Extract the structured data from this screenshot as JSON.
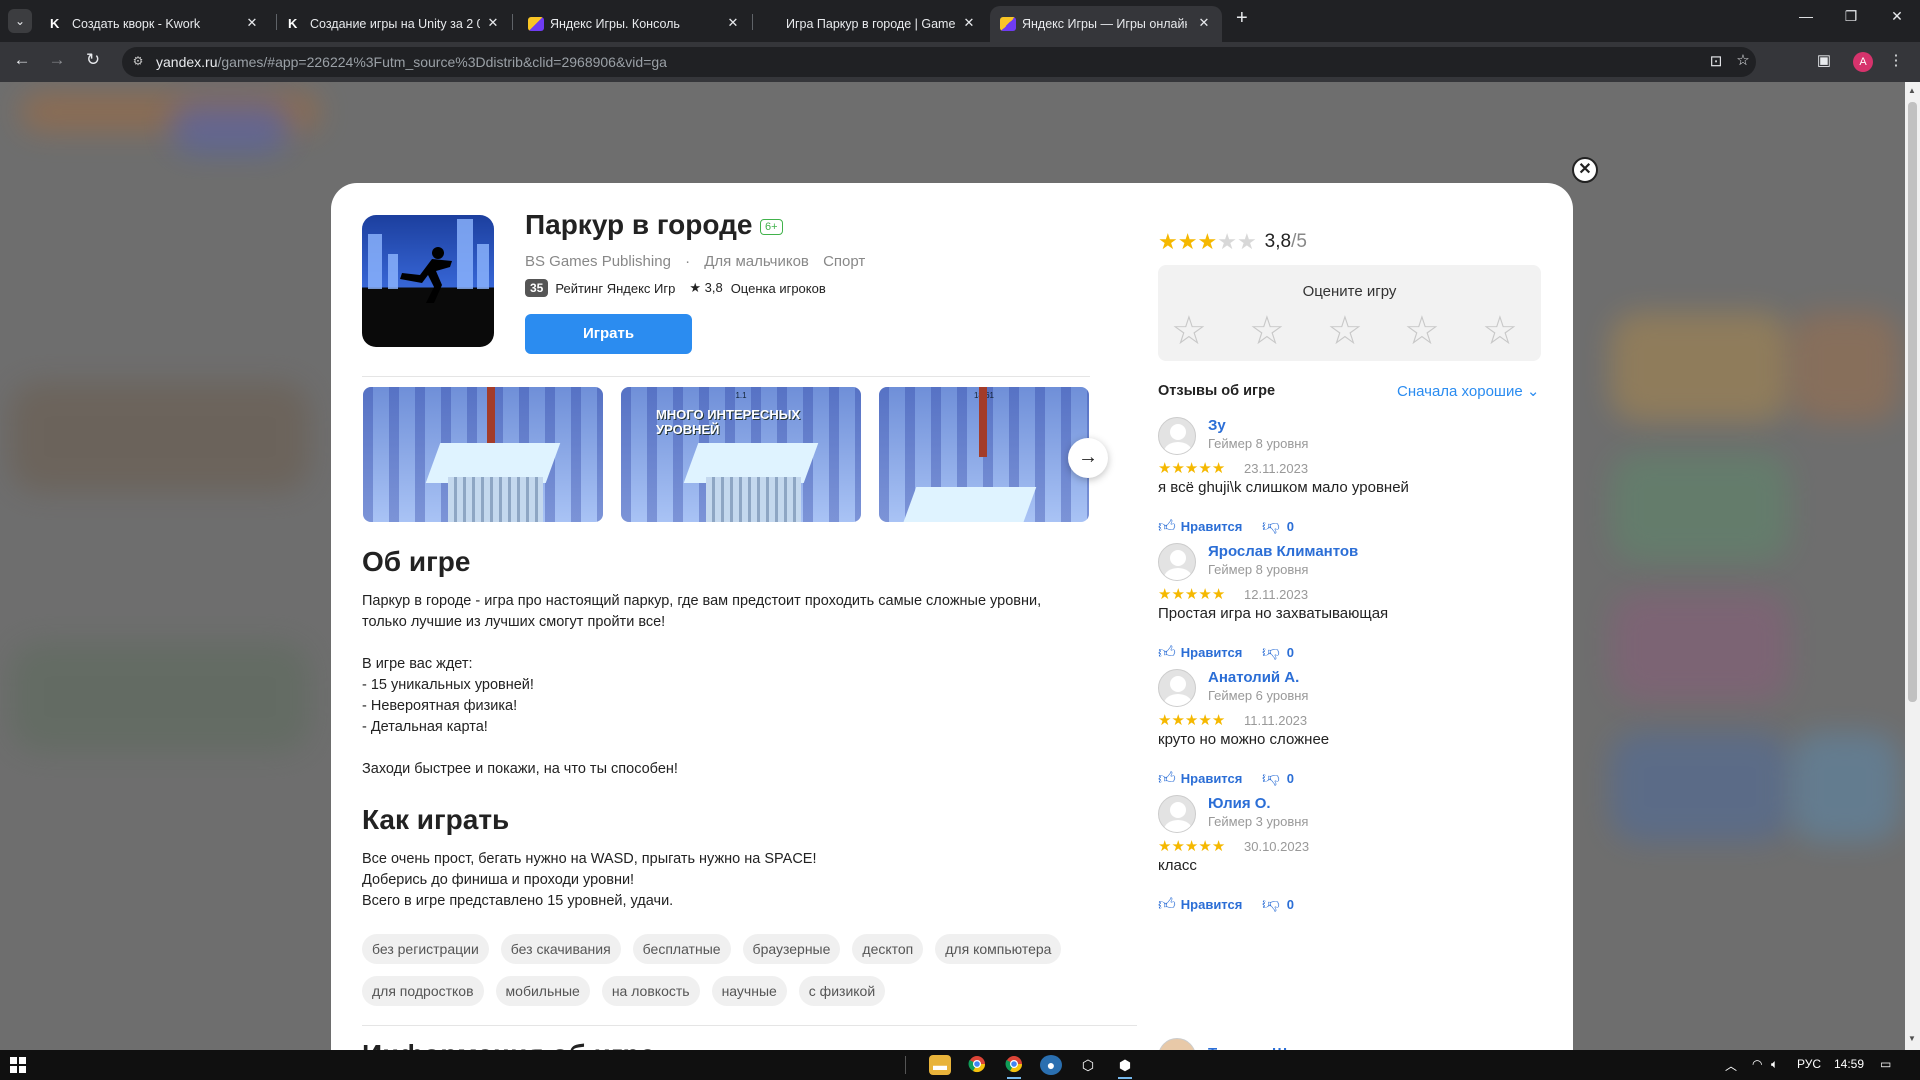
{
  "browser": {
    "tabs": [
      {
        "title": "Создать кворк - Kwork",
        "icon": "kwork-icon",
        "active": false
      },
      {
        "title": "Создание игры на Unity за 2 0",
        "icon": "kwork-icon",
        "active": false
      },
      {
        "title": "Яндекс Игры. Консоль",
        "icon": "yandex-games-icon",
        "active": false
      },
      {
        "title": "Игра Паркур в городе | Game",
        "icon": "",
        "active": false
      },
      {
        "title": "Яндекс Игры — Игры онлайн",
        "icon": "yandex-games-icon",
        "active": true
      }
    ],
    "url_host": "yandex.ru",
    "url_path": "/games/#app=226224%3Futm_source%3Ddistrib&clid=2968906&vid=ga",
    "profile_initial": "A"
  },
  "game": {
    "title": "Паркур в городе",
    "age": "6+",
    "publisher": "BS Games Publishing",
    "categories": [
      "Для мальчиков",
      "Спорт"
    ],
    "rank": "35",
    "rank_label": "Рейтинг Яндекс Игр",
    "player_rating": "★ 3,8",
    "player_rating_label": "Оценка игроков",
    "play_label": "Играть",
    "screenshots": [
      {
        "banner": ""
      },
      {
        "banner": "МНОГО ИНТЕРЕСНЫХ УРОВНЕЙ",
        "hud": "1.1"
      },
      {
        "banner": "",
        "hud": "18.61"
      }
    ]
  },
  "about": {
    "heading": "Об игре",
    "paragraphs": [
      "Паркур в городе - игра про настоящий паркур, где вам предстоит проходить самые сложные уровни, только лучшие из лучших смогут пройти все!",
      "В игре вас ждет:",
      "- 15 уникальных уровней!",
      "- Невероятная физика!",
      "- Детальная карта!",
      "Заходи быстрее и покажи, на что ты способен!"
    ]
  },
  "howto": {
    "heading": "Как играть",
    "lines": [
      "Все очень прост, бегать нужно на WASD, прыгать нужно на SPACE!",
      "Доберись до финиша и проходи уровни!",
      "Всего в игре представлено 15 уровней, удачи."
    ]
  },
  "tags": [
    "без регистрации",
    "без скачивания",
    "бесплатные",
    "браузерные",
    "десктоп",
    "для компьютера",
    "для подростков",
    "мобильные",
    "на ловкость",
    "научные",
    "с физикой"
  ],
  "info_heading": "Информация об игре",
  "rating": {
    "value": "3,8",
    "out_of": "/5",
    "stars_filled": 3,
    "rate_prompt": "Оцените игру"
  },
  "reviews": {
    "heading": "Отзывы об игре",
    "sort_label": "Сначала хорошие",
    "like_label": "Нравится",
    "items": [
      {
        "name": "Зу",
        "level": "Геймер 8 уровня",
        "date": "23.11.2023",
        "text": "я всё ghuji\\k слишком мало уровней",
        "dislikes": "0"
      },
      {
        "name": "Ярослав Климантов",
        "level": "Геймер 8 уровня",
        "date": "12.11.2023",
        "text": "Простая игра но захватывающая",
        "dislikes": "0"
      },
      {
        "name": "Анатолий А.",
        "level": "Геймер 6 уровня",
        "date": "11.11.2023",
        "text": "круто но можно сложнее",
        "dislikes": "0"
      },
      {
        "name": "Юлия О.",
        "level": "Геймер 3 уровня",
        "date": "30.10.2023",
        "text": "класс",
        "dislikes": "0"
      },
      {
        "name": "Татьяна Шульга",
        "level": "",
        "date": "",
        "text": "",
        "dislikes": ""
      }
    ]
  },
  "taskbar": {
    "lang": "РУС",
    "time": "14:59"
  }
}
